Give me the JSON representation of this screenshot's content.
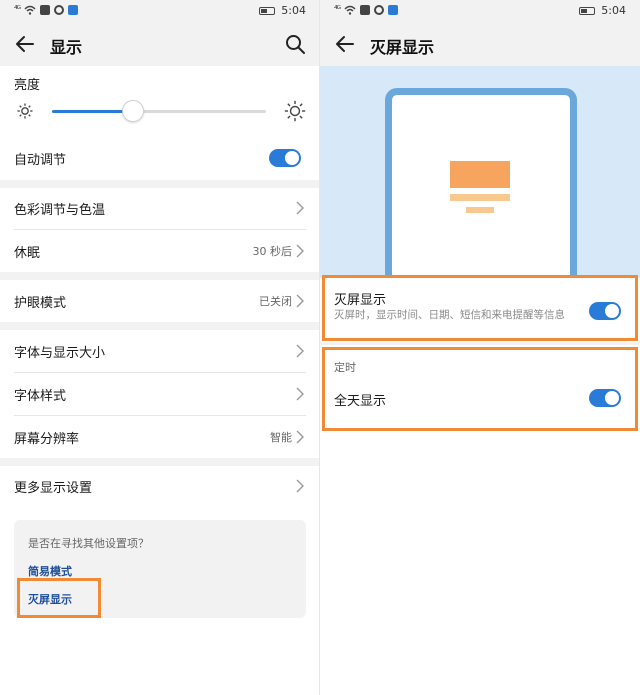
{
  "status_bar": {
    "signal": "⁴ᴳ",
    "time": "5:04"
  },
  "left": {
    "app_bar": {
      "title": "显示"
    },
    "brightness": {
      "label": "亮度",
      "level_percent": 38
    },
    "auto_adjust": {
      "label": "自动调节",
      "enabled": true
    },
    "rows": {
      "color_temp": {
        "label": "色彩调节与色温"
      },
      "sleep": {
        "label": "休眠",
        "value": "30 秒后"
      },
      "eye_comfort": {
        "label": "护眼模式",
        "value": "已关闭"
      },
      "font_size": {
        "label": "字体与显示大小"
      },
      "font_style": {
        "label": "字体样式"
      },
      "resolution": {
        "label": "屏幕分辨率",
        "value": "智能"
      },
      "more": {
        "label": "更多显示设置"
      }
    },
    "suggest": {
      "title": "是否在寻找其他设置项？",
      "link1": "简易模式",
      "link2": "灭屏显示"
    }
  },
  "right": {
    "app_bar": {
      "title": "灭屏显示"
    },
    "aod": {
      "title": "灭屏显示",
      "description": "灭屏时，显示时间、日期、短信和来电提醒等信息",
      "enabled": true
    },
    "timer": {
      "section_label": "定时",
      "all_day_label": "全天显示",
      "all_day_enabled": true
    }
  },
  "colors": {
    "accent": "#2a7bd8",
    "highlight": "#f08a37",
    "link": "#1f4f99",
    "preview_bg": "#d7e8f8"
  },
  "icons": [
    "back-arrow-icon",
    "search-icon",
    "sun-small-icon",
    "sun-large-icon",
    "chevron-right-icon",
    "wifi-icon",
    "battery-icon"
  ]
}
